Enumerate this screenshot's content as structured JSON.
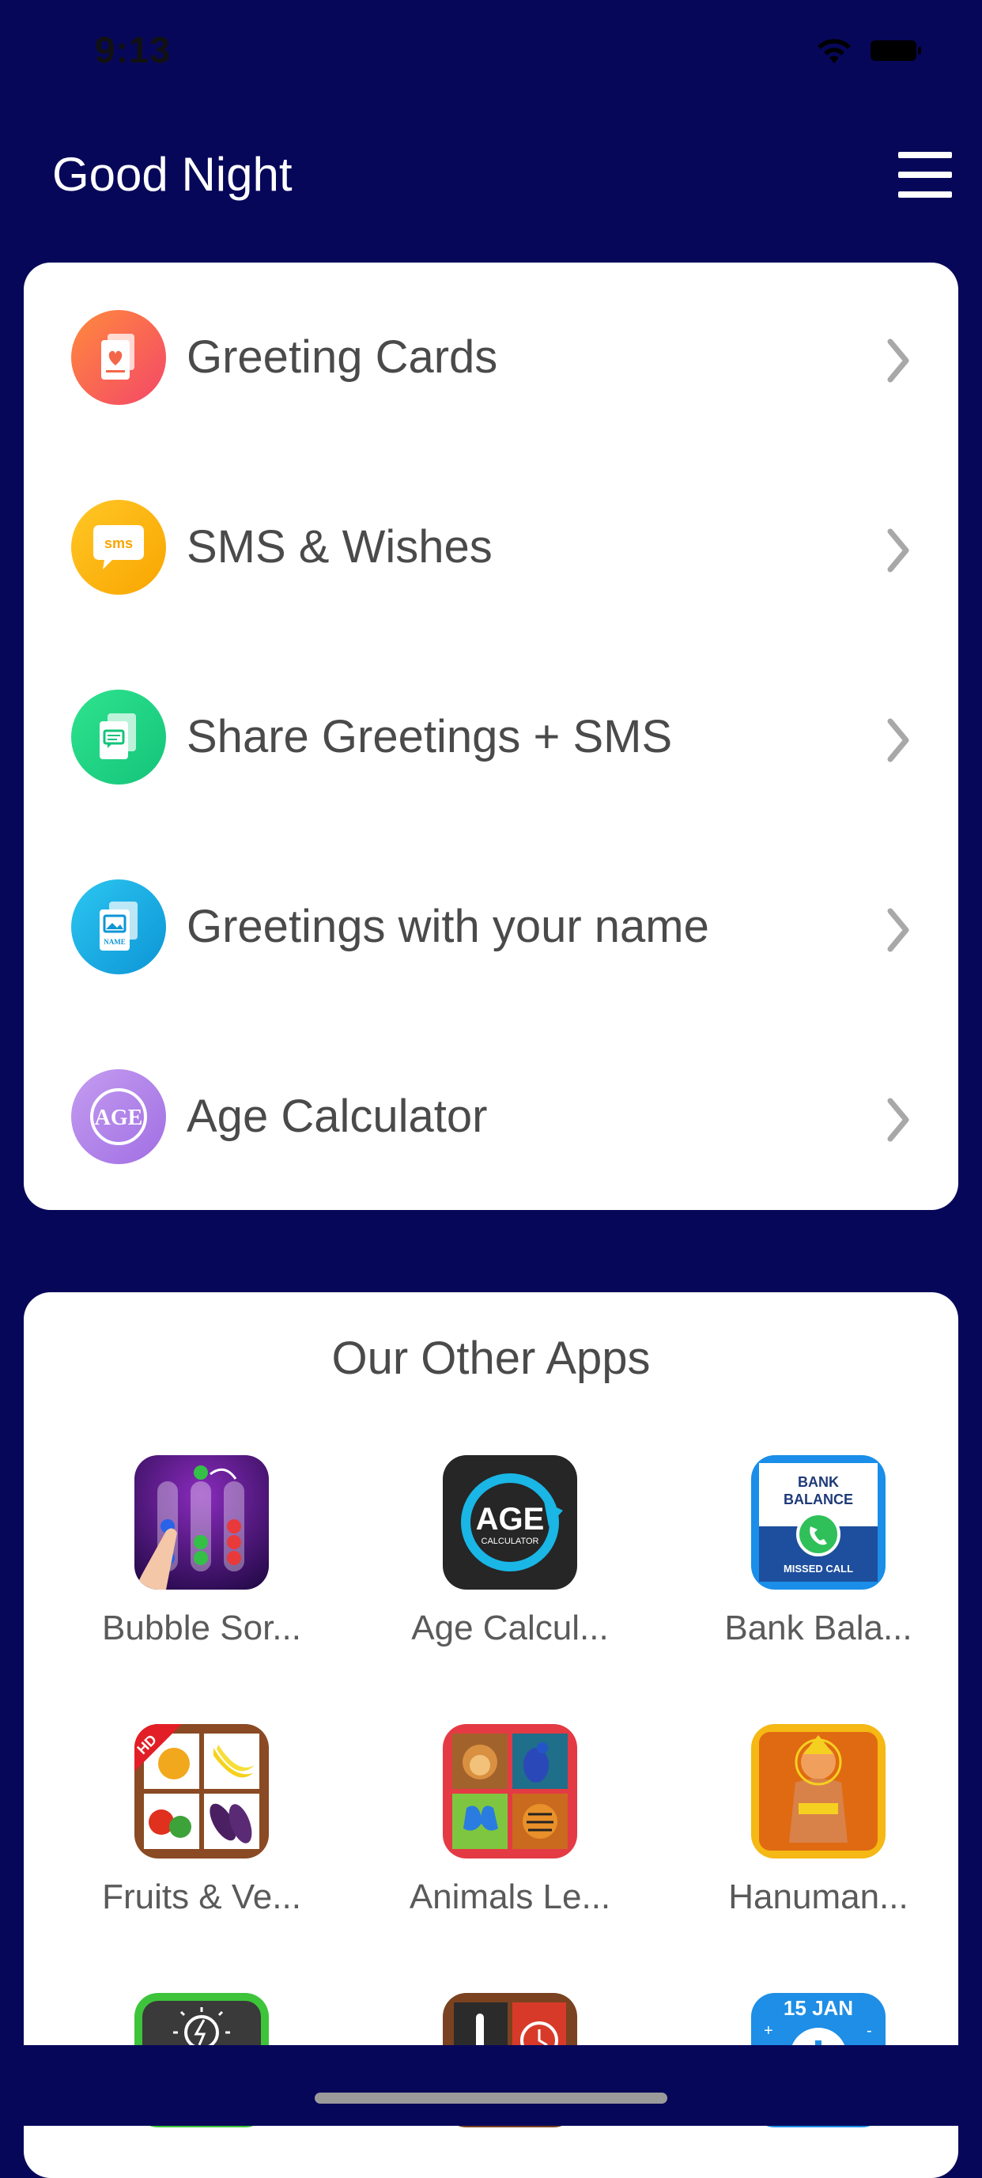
{
  "status_bar": {
    "time": "9:13"
  },
  "header": {
    "title": "Good Night"
  },
  "menu": {
    "items": [
      {
        "label": "Greeting Cards",
        "icon": "greeting-card-icon",
        "color": "#f4664a"
      },
      {
        "label": "SMS & Wishes",
        "icon": "sms-icon",
        "color": "#fbb90c",
        "icon_text": "sms"
      },
      {
        "label": "Share Greetings + SMS",
        "icon": "share-icon",
        "color": "#1fcf7f"
      },
      {
        "label": "Greetings with your name",
        "icon": "name-card-icon",
        "color": "#1aafe0",
        "icon_text": "NAME"
      },
      {
        "label": "Age Calculator",
        "icon": "age-icon",
        "color": "#b184ea",
        "icon_text": "AGE"
      }
    ]
  },
  "other_apps": {
    "title": "Our Other Apps",
    "apps": [
      {
        "label": "Bubble Sor...",
        "icon": "bubble-sort-app-icon"
      },
      {
        "label": "Age Calcul...",
        "icon": "age-calculator-app-icon",
        "icon_text": "AGE",
        "icon_subtext": "CALCULATOR"
      },
      {
        "label": "Bank Bala...",
        "icon": "bank-balance-app-icon",
        "icon_text": "BANK BALANCE",
        "icon_subtext": "MISSED CALL"
      },
      {
        "label": "Fruits & Ve...",
        "icon": "fruits-vegetables-app-icon",
        "icon_text": "HD"
      },
      {
        "label": "Animals Le...",
        "icon": "animals-app-icon"
      },
      {
        "label": "Hanuman...",
        "icon": "hanuman-app-icon"
      },
      {
        "label": "",
        "icon": "flashlight-app-icon"
      },
      {
        "label": "",
        "icon": "thermometer-app-icon"
      },
      {
        "label": "",
        "icon": "calendar-app-icon",
        "icon_text": "15 JAN"
      }
    ]
  }
}
